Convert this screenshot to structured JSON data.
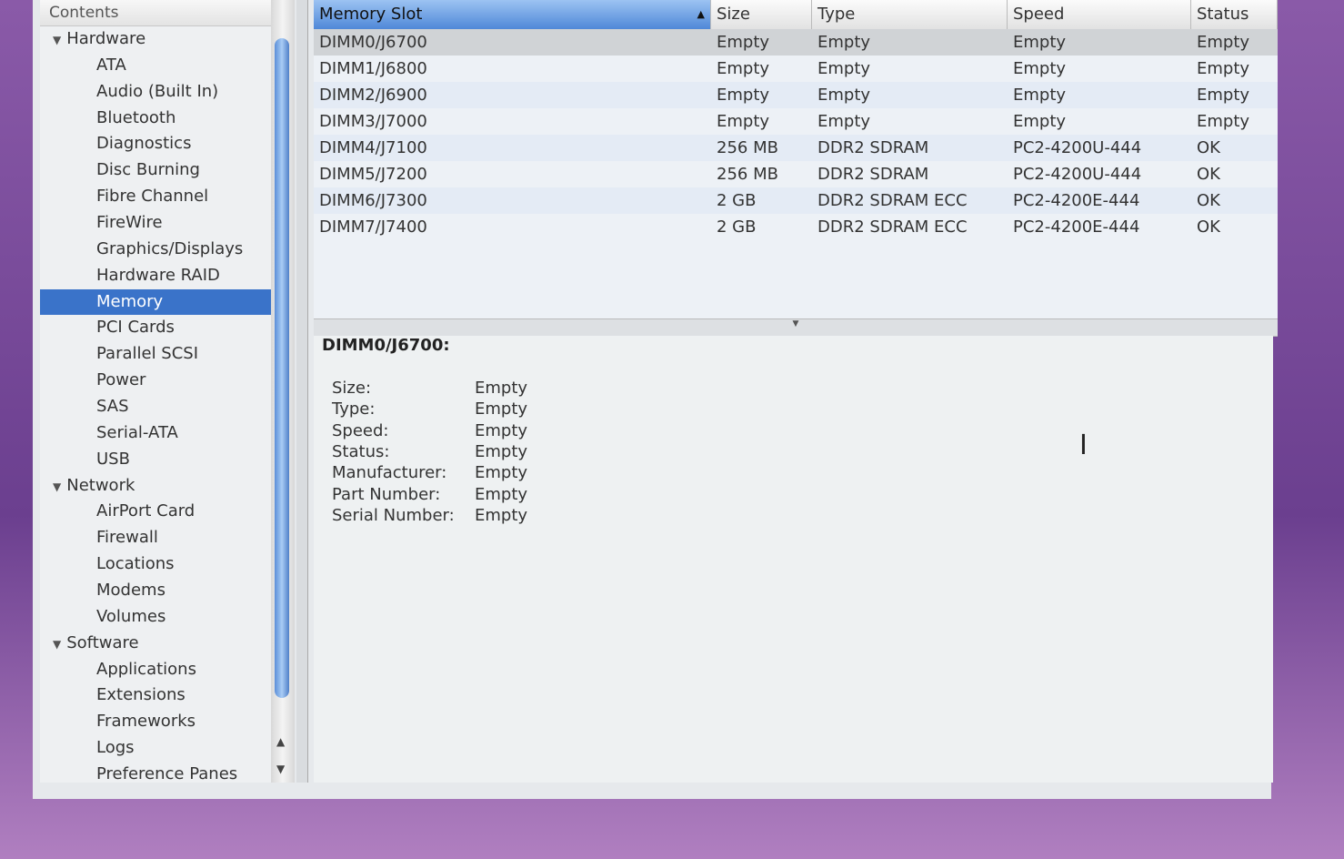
{
  "sidebar": {
    "header": "Contents",
    "items": [
      {
        "label": "Hardware",
        "group": true
      },
      {
        "label": "ATA"
      },
      {
        "label": "Audio (Built In)"
      },
      {
        "label": "Bluetooth"
      },
      {
        "label": "Diagnostics"
      },
      {
        "label": "Disc Burning"
      },
      {
        "label": "Fibre Channel"
      },
      {
        "label": "FireWire"
      },
      {
        "label": "Graphics/Displays"
      },
      {
        "label": "Hardware RAID"
      },
      {
        "label": "Memory",
        "selected": true
      },
      {
        "label": "PCI Cards"
      },
      {
        "label": "Parallel SCSI"
      },
      {
        "label": "Power"
      },
      {
        "label": "SAS"
      },
      {
        "label": "Serial-ATA"
      },
      {
        "label": "USB"
      },
      {
        "label": "Network",
        "group": true
      },
      {
        "label": "AirPort Card"
      },
      {
        "label": "Firewall"
      },
      {
        "label": "Locations"
      },
      {
        "label": "Modems"
      },
      {
        "label": "Volumes"
      },
      {
        "label": "Software",
        "group": true
      },
      {
        "label": "Applications"
      },
      {
        "label": "Extensions"
      },
      {
        "label": "Frameworks"
      },
      {
        "label": "Logs"
      },
      {
        "label": "Preference Panes"
      }
    ]
  },
  "table": {
    "columns": [
      "Memory Slot",
      "Size",
      "Type",
      "Speed",
      "Status"
    ],
    "sort_indicator": "▲",
    "rows": [
      [
        "DIMM0/J6700",
        "Empty",
        "Empty",
        "Empty",
        "Empty"
      ],
      [
        "DIMM1/J6800",
        "Empty",
        "Empty",
        "Empty",
        "Empty"
      ],
      [
        "DIMM2/J6900",
        "Empty",
        "Empty",
        "Empty",
        "Empty"
      ],
      [
        "DIMM3/J7000",
        "Empty",
        "Empty",
        "Empty",
        "Empty"
      ],
      [
        "DIMM4/J7100",
        "256 MB",
        "DDR2 SDRAM",
        "PC2-4200U-444",
        "OK"
      ],
      [
        "DIMM5/J7200",
        "256 MB",
        "DDR2 SDRAM",
        "PC2-4200U-444",
        "OK"
      ],
      [
        "DIMM6/J7300",
        "2 GB",
        "DDR2 SDRAM ECC",
        "PC2-4200E-444",
        "OK"
      ],
      [
        "DIMM7/J7400",
        "2 GB",
        "DDR2 SDRAM ECC",
        "PC2-4200E-444",
        "OK"
      ]
    ]
  },
  "detail": {
    "title": "DIMM0/J6700:",
    "fields": [
      {
        "label": "Size:",
        "value": "Empty"
      },
      {
        "label": "Type:",
        "value": "Empty"
      },
      {
        "label": "Speed:",
        "value": "Empty"
      },
      {
        "label": "Status:",
        "value": "Empty"
      },
      {
        "label": "Manufacturer:",
        "value": "Empty"
      },
      {
        "label": "Part Number:",
        "value": "Empty"
      },
      {
        "label": "Serial Number:",
        "value": "Empty"
      }
    ]
  },
  "colors": {
    "selection": "#3a73c9",
    "sorted_header": "#4f88d8"
  }
}
